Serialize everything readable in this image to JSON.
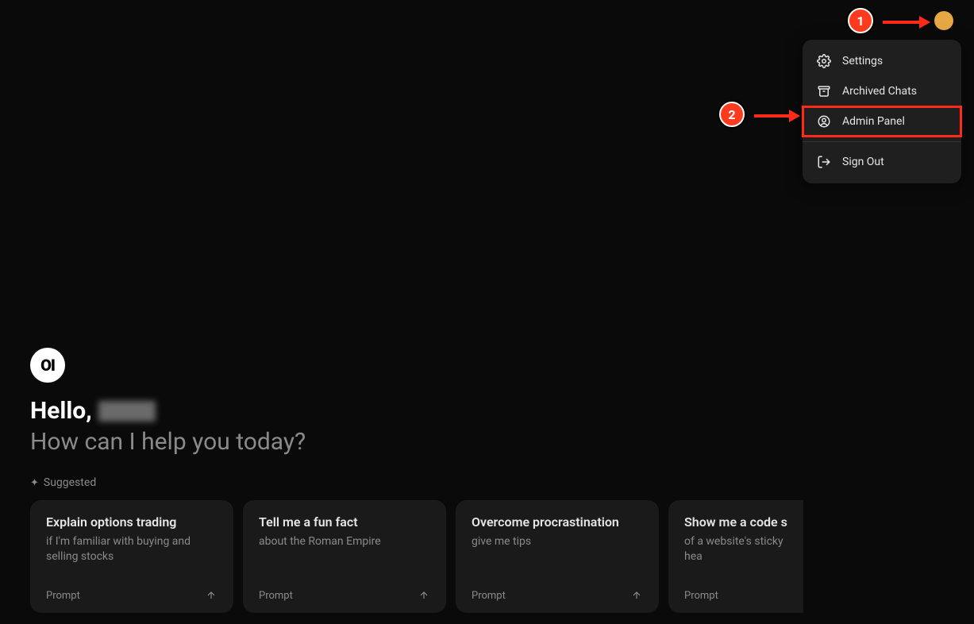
{
  "dropdown": {
    "items": [
      {
        "label": "Settings"
      },
      {
        "label": "Archived Chats"
      },
      {
        "label": "Admin Panel"
      },
      {
        "label": "Sign Out"
      }
    ]
  },
  "callouts": {
    "one": "1",
    "two": "2"
  },
  "logo_text": "OI",
  "greeting_prefix": "Hello,",
  "subtitle": "How can I help you today?",
  "suggested_label": "Suggested",
  "cards": [
    {
      "title": "Explain options trading",
      "sub": "if I'm familiar with buying and selling stocks",
      "footer": "Prompt"
    },
    {
      "title": "Tell me a fun fact",
      "sub": "about the Roman Empire",
      "footer": "Prompt"
    },
    {
      "title": "Overcome procrastination",
      "sub": "give me tips",
      "footer": "Prompt"
    },
    {
      "title": "Show me a code sn",
      "sub": "of a website's sticky hea",
      "footer": "Prompt"
    }
  ]
}
